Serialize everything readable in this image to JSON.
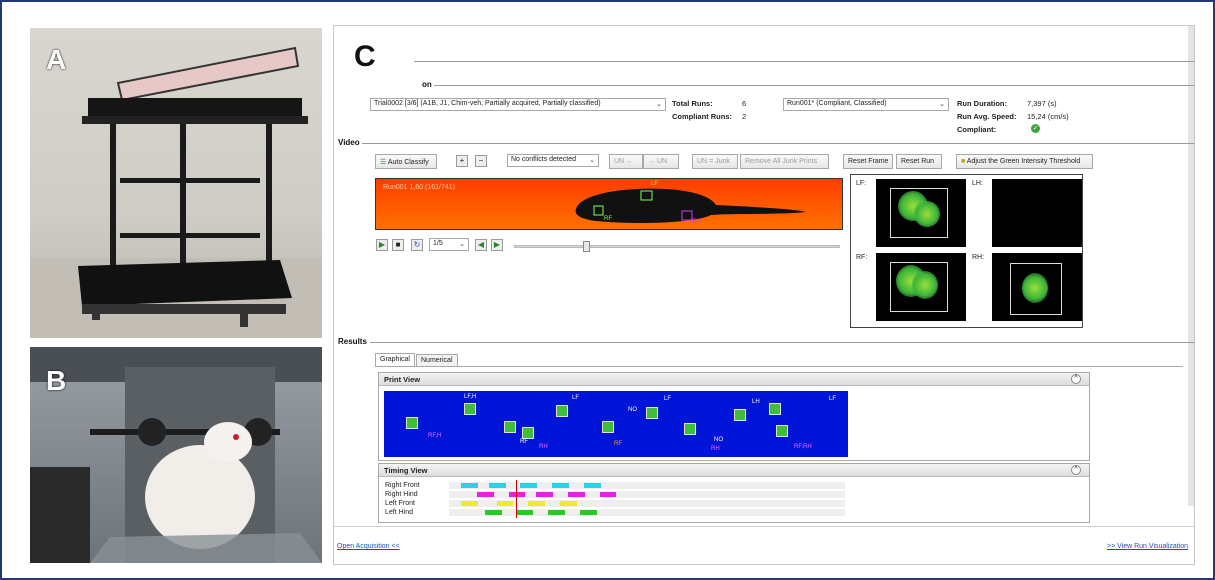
{
  "panels": {
    "a": "A",
    "b": "B",
    "c": "C"
  },
  "header": {
    "section_partial": "on"
  },
  "acquisition": {
    "trial_select": "Trial0002 [3/6] (A1B, J1, Chim-veh, Partially acquired, Partially classified)",
    "total_runs_label": "Total Runs:",
    "total_runs_value": "6",
    "compliant_runs_label": "Compliant Runs:",
    "compliant_runs_value": "2",
    "run_select": "Run001* (Compliant, Classified)",
    "run_duration_label": "Run Duration:",
    "run_duration_value": "7,397 (s)",
    "run_avg_speed_label": "Run Avg. Speed:",
    "run_avg_speed_value": "15,24 (cm/s)",
    "compliant_label": "Compliant:"
  },
  "video": {
    "section_label": "Video",
    "auto_classify": "Auto Classify",
    "conflicts_select": "No conflicts detected",
    "un_prev": "UN",
    "un_next": "UN",
    "un_junk": "UN = Junk",
    "remove_junk": "Remove All Junk Prints",
    "reset_frame": "Reset Frame",
    "reset_run": "Reset Run",
    "adjust_threshold": "Adjust the Green Intensity Threshold",
    "frame_overlay": "Run001 1,60 (161/741)",
    "overlay_lf": "LF",
    "overlay_rf": "RF",
    "overlay_rh": "RH",
    "speed_select": "1/5",
    "paw_labels": {
      "lf": "LF:",
      "lh": "LH:",
      "rf": "RF:",
      "rh": "RH:"
    }
  },
  "results": {
    "section_label": "Results",
    "tabs": [
      "Graphical",
      "Numerical"
    ],
    "print_view_title": "Print View",
    "timing_view_title": "Timing View",
    "print_labels": [
      "LF,H",
      "LF",
      "LF",
      "LH",
      "LF",
      "RF,H",
      "RF",
      "RH",
      "RF",
      "NO",
      "RH",
      "NO",
      "RF,RH"
    ],
    "timing_rows": [
      {
        "label": "Right Front",
        "color": "#27d3e8",
        "bars": [
          0.0,
          0.07,
          0.15,
          0.23,
          0.31
        ]
      },
      {
        "label": "Right Hind",
        "color": "#e81ee0",
        "bars": [
          0.04,
          0.12,
          0.19,
          0.27,
          0.35
        ]
      },
      {
        "label": "Left Front",
        "color": "#ecec2a",
        "bars": [
          0.0,
          0.09,
          0.17,
          0.25
        ]
      },
      {
        "label": "Left Hind",
        "color": "#22cc22",
        "bars": [
          0.06,
          0.14,
          0.22,
          0.3
        ]
      }
    ]
  },
  "footer": {
    "open_acquisition": "Open Acquisition <<",
    "view_run": ">> View Run Visualization"
  },
  "colors": {
    "frame_border": "#1f3b73",
    "print_bg": "#0015d8",
    "video_bg": "#ff4a00"
  }
}
